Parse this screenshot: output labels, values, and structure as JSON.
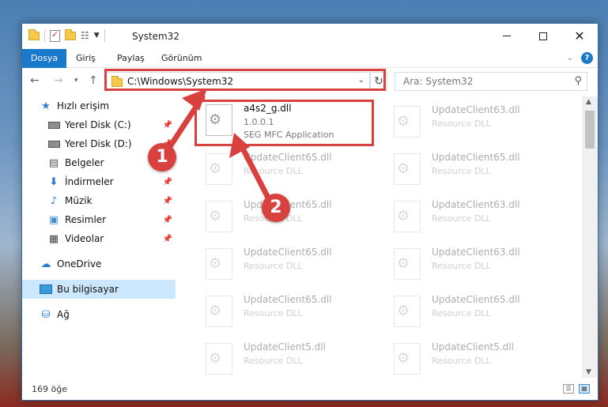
{
  "window": {
    "title": "System32",
    "buttons": {
      "minimize": "—",
      "maximize": "□",
      "close": "✕"
    }
  },
  "ribbon": {
    "tabs": [
      "Dosya",
      "Giriş",
      "Paylaş",
      "Görünüm"
    ],
    "help": "?"
  },
  "nav": {
    "address": "C:\\Windows\\System32",
    "search_placeholder": "Ara: System32"
  },
  "sidebar": {
    "items": [
      {
        "label": "Hızlı erişim",
        "icon": "star-icon"
      },
      {
        "label": "Yerel Disk (C:)",
        "icon": "disk-icon",
        "pinned": true
      },
      {
        "label": "Yerel Disk (D:)",
        "icon": "disk-icon",
        "pinned": true
      },
      {
        "label": "Belgeler",
        "icon": "documents-icon"
      },
      {
        "label": "İndirmeler",
        "icon": "download-icon",
        "pinned": true
      },
      {
        "label": "Müzik",
        "icon": "music-icon",
        "pinned": true
      },
      {
        "label": "Resimler",
        "icon": "pictures-icon",
        "pinned": true
      },
      {
        "label": "Videolar",
        "icon": "videos-icon",
        "pinned": true
      },
      {
        "label": "OneDrive",
        "icon": "onedrive-icon"
      },
      {
        "label": "Bu bilgisayar",
        "icon": "this-pc-icon",
        "selected": true
      },
      {
        "label": "Ağ",
        "icon": "network-icon"
      }
    ]
  },
  "files": {
    "highlighted": {
      "name": "a4s2_g.dll",
      "version": "1.0.0.1",
      "description": "SEG MFC Application"
    },
    "background": [
      {
        "name": "UpdateClient63.dll",
        "description": "Resource DLL"
      },
      {
        "name": "UpdateClient65.dll",
        "description": "Resource DLL"
      },
      {
        "name": "UpdateClient65.dll",
        "description": "Resource DLL"
      },
      {
        "name": "UpdateClient65.dll",
        "description": "Resource DLL"
      },
      {
        "name": "UpdateClient63.dll",
        "description": "Resource DLL"
      },
      {
        "name": "UpdateClient65.dll",
        "description": "Resource DLL"
      },
      {
        "name": "UpdateClient63.dll",
        "description": "Resource DLL"
      },
      {
        "name": "UpdateClient65.dll",
        "description": "Resource DLL"
      },
      {
        "name": "UpdateClient5.dll",
        "description": "Resource DLL"
      },
      {
        "name": "UpdateClient65.dll",
        "description": "Resource DLL"
      }
    ]
  },
  "status": {
    "count": "169 öğe"
  },
  "annotations": {
    "step1": "1",
    "step2": "2",
    "color": "#d9413f"
  }
}
